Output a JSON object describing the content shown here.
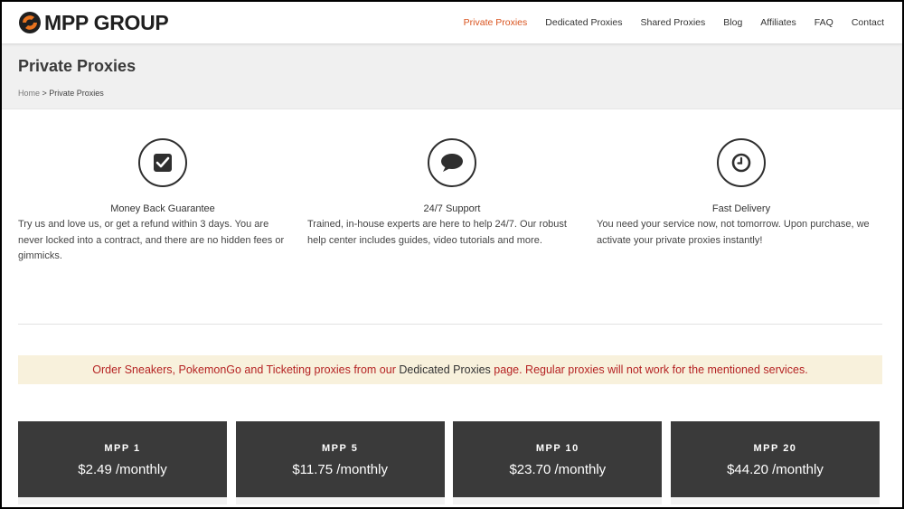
{
  "header": {
    "logo_text": "MPP GROUP",
    "nav": [
      {
        "label": "Private Proxies",
        "active": true
      },
      {
        "label": "Dedicated Proxies",
        "active": false
      },
      {
        "label": "Shared Proxies",
        "active": false
      },
      {
        "label": "Blog",
        "active": false
      },
      {
        "label": "Affiliates",
        "active": false
      },
      {
        "label": "FAQ",
        "active": false
      },
      {
        "label": "Contact",
        "active": false
      }
    ]
  },
  "page": {
    "title": "Private Proxies",
    "breadcrumb": {
      "home": "Home",
      "separator": " > ",
      "current": "Private Proxies"
    }
  },
  "features": [
    {
      "icon": "checkbox-icon",
      "title": "Money Back Guarantee",
      "description": "Try us and love us, or get a refund within 3 days. You are never locked into a contract, and there are no hidden fees or gimmicks."
    },
    {
      "icon": "chat-bubble-icon",
      "title": "24/7 Support",
      "description": "Trained, in-house experts are here to help 24/7. Our robust help center includes guides, video tutorials and more."
    },
    {
      "icon": "clock-icon",
      "title": "Fast Delivery",
      "description": "You need your service now, not tomorrow. Upon purchase, we activate your private proxies instantly!"
    }
  ],
  "notice": {
    "prefix": "Order Sneakers, PokemonGo and Ticketing proxies from our ",
    "link": "Dedicated Proxies",
    "suffix": " page. Regular proxies will not work for the mentioned services."
  },
  "plans": [
    {
      "name": "MPP 1",
      "price": "$2.49 /monthly"
    },
    {
      "name": "MPP 5",
      "price": "$11.75 /monthly"
    },
    {
      "name": "MPP 10",
      "price": "$23.70 /monthly"
    },
    {
      "name": "MPP 20",
      "price": "$44.20 /monthly"
    }
  ],
  "colors": {
    "accent": "#d9531e",
    "plan_bg": "#3a3a3a",
    "notice_bg": "#f8f1dc",
    "notice_text": "#b52323"
  }
}
